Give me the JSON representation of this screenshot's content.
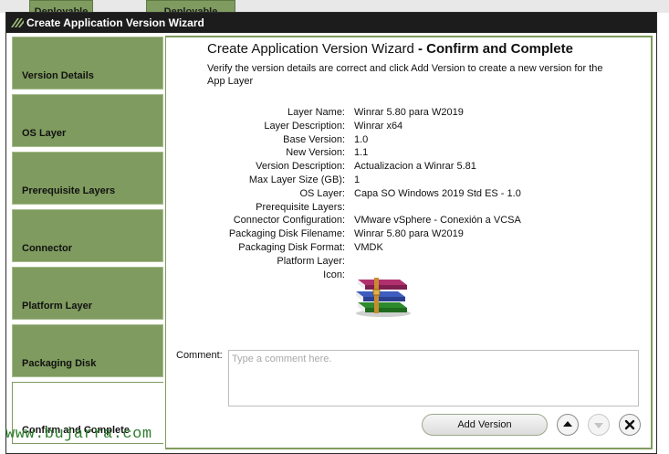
{
  "background": {
    "tabs": [
      "Deployable",
      "Deployable"
    ]
  },
  "window": {
    "title": "Create Application Version Wizard"
  },
  "steps": [
    {
      "label": "Version Details"
    },
    {
      "label": "OS Layer"
    },
    {
      "label": "Prerequisite Layers"
    },
    {
      "label": "Connector"
    },
    {
      "label": "Platform Layer"
    },
    {
      "label": "Packaging Disk"
    },
    {
      "label": "Confirm and Complete",
      "active": true
    }
  ],
  "header": {
    "title_prefix": "Create Application Version Wizard",
    "title_suffix": " - Confirm and Complete",
    "intro": "Verify the version details are correct and click Add Version to create a new version for the App Layer"
  },
  "details": [
    {
      "key": "Layer Name:",
      "value": "Winrar 5.80 para W2019"
    },
    {
      "key": "Layer Description:",
      "value": "Winrar x64"
    },
    {
      "key": "Base Version:",
      "value": "1.0"
    },
    {
      "key": "New Version:",
      "value": "1.1"
    },
    {
      "key": "Version Description:",
      "value": "Actualizacion a Winrar 5.81"
    },
    {
      "key": "Max Layer Size (GB):",
      "value": "1"
    },
    {
      "key": "OS Layer:",
      "value": "Capa SO Windows 2019 Std ES - 1.0"
    },
    {
      "key": "Prerequisite Layers:",
      "value": ""
    },
    {
      "key": "Connector Configuration:",
      "value": "VMware vSphere - Conexión a VCSA"
    },
    {
      "key": "Packaging Disk Filename:",
      "value": "Winrar 5.80 para W2019"
    },
    {
      "key": "Packaging Disk Format:",
      "value": "VMDK"
    },
    {
      "key": "Platform Layer:",
      "value": ""
    },
    {
      "key": "Icon:",
      "value": ""
    }
  ],
  "icon": "winrar-books-icon",
  "comment": {
    "label": "Comment:",
    "placeholder": "Type a comment here.",
    "value": ""
  },
  "buttons": {
    "add_version": "Add Version",
    "up": "arrow-up-icon",
    "down": "arrow-down-icon",
    "close": "close-icon"
  },
  "watermark": "www.bujarra.com",
  "colors": {
    "accent": "#7f9b5f",
    "titlebar": "#1c1c1c"
  }
}
